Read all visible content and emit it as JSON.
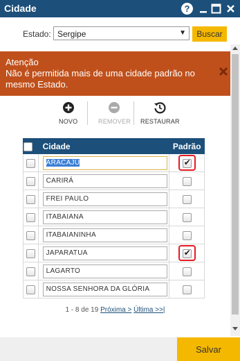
{
  "window": {
    "title": "Cidade",
    "help_label": "?"
  },
  "filter": {
    "label": "Estado:",
    "selected": "Sergipe",
    "search_label": "Buscar"
  },
  "alert": {
    "title": "Atenção",
    "message": "Não é permitida mais de uma cidade padrão no mesmo Estado.",
    "color": "#c0501b"
  },
  "toolbar": {
    "new_label": "NOVO",
    "remove_label": "REMOVER",
    "restore_label": "RESTAURAR"
  },
  "table": {
    "col_city": "Cidade",
    "col_default": "Padrão",
    "rows": [
      {
        "city": "ARACAJÚ",
        "default": true,
        "focused": true
      },
      {
        "city": "CARIRÁ",
        "default": false
      },
      {
        "city": "FREI PAULO",
        "default": false
      },
      {
        "city": "ITABAIANA",
        "default": false
      },
      {
        "city": "ITABAIANINHA",
        "default": false
      },
      {
        "city": "JAPARATUA",
        "default": true
      },
      {
        "city": "LAGARTO",
        "default": false
      },
      {
        "city": "NOSSA SENHORA DA GLÓRIA",
        "default": false
      }
    ]
  },
  "pager": {
    "summary": "1 - 8 de 19",
    "next": "Próxima >",
    "last": "Última >>|"
  },
  "footer": {
    "save_label": "Salvar"
  },
  "colors": {
    "header": "#1c4f7a",
    "accent": "#f5b800",
    "highlight": "#e31b23"
  }
}
